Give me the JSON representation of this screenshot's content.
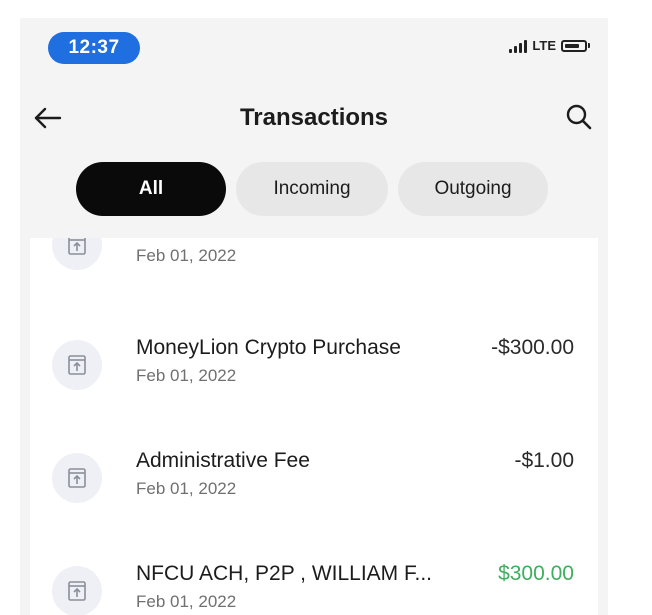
{
  "status_bar": {
    "time": "12:37",
    "network": "LTE",
    "accent_color": "#1f6fe0"
  },
  "header": {
    "title": "Transactions",
    "back_icon": "arrow-left-icon",
    "search_icon": "search-icon"
  },
  "filters": {
    "selected": "All",
    "tabs": [
      {
        "label": "All"
      },
      {
        "label": "Incoming"
      },
      {
        "label": "Outgoing"
      }
    ]
  },
  "transactions": [
    {
      "title": "",
      "date": "Feb 01, 2022",
      "amount": "",
      "icon": "outgoing-transfer-icon"
    },
    {
      "title": "MoneyLion Crypto Purchase",
      "date": "Feb 01, 2022",
      "amount": "-$300.00",
      "direction": "outgoing",
      "icon": "outgoing-transfer-icon"
    },
    {
      "title": "Administrative Fee",
      "date": "Feb 01, 2022",
      "amount": "-$1.00",
      "direction": "outgoing",
      "icon": "outgoing-transfer-icon"
    },
    {
      "title": "NFCU ACH, P2P , WILLIAM F...",
      "date": "Feb 01, 2022",
      "amount": "$300.00",
      "direction": "incoming",
      "icon": "outgoing-transfer-icon"
    }
  ],
  "colors": {
    "positive_amount": "#3fae5e",
    "active_tab": "#0a0a0a",
    "inactive_tab": "#e7e7e7"
  }
}
